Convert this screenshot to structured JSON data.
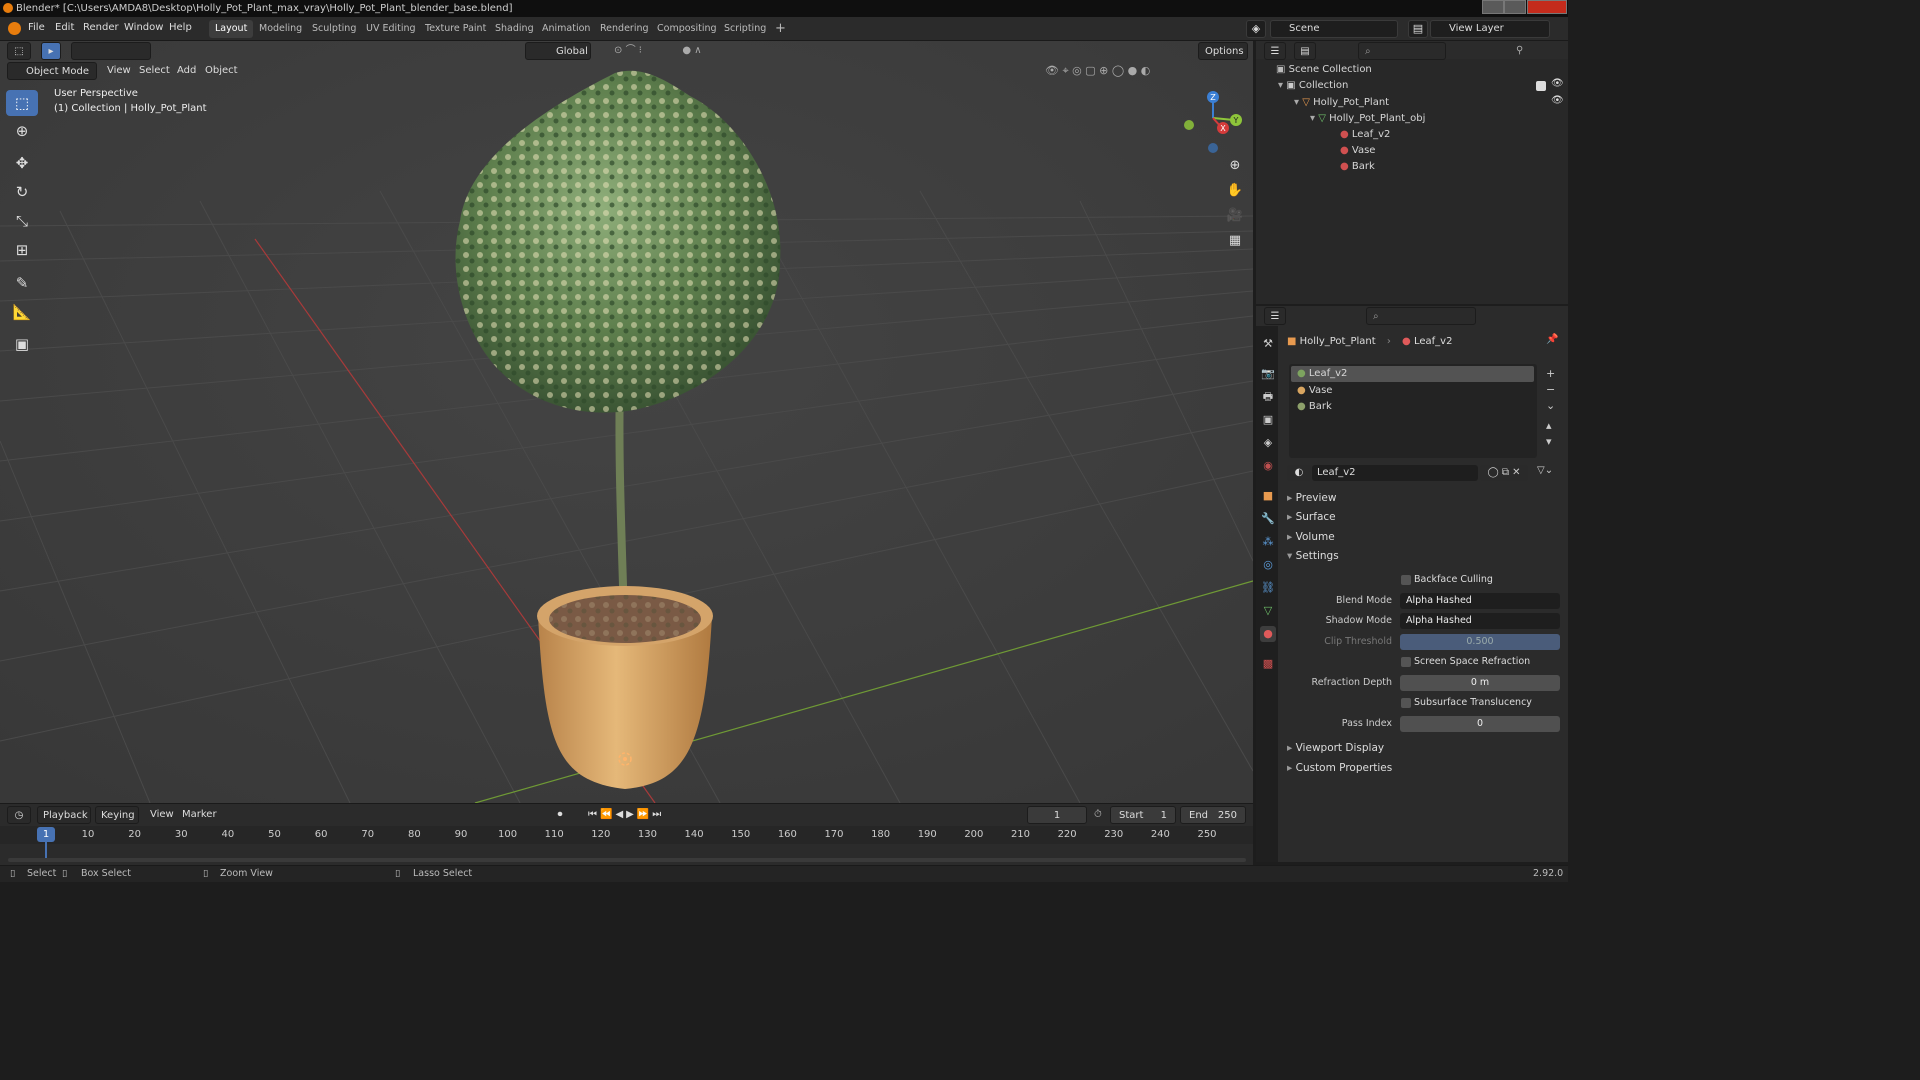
{
  "window": {
    "title": "Blender* [C:\\Users\\AMDA8\\Desktop\\Holly_Pot_Plant_max_vray\\Holly_Pot_Plant_blender_base.blend]"
  },
  "menu": [
    "File",
    "Edit",
    "Render",
    "Window",
    "Help"
  ],
  "workspaces": [
    "Layout",
    "Modeling",
    "Sculpting",
    "UV Editing",
    "Texture Paint",
    "Shading",
    "Animation",
    "Rendering",
    "Compositing",
    "Scripting"
  ],
  "active_workspace": "Layout",
  "scene": {
    "name": "Scene",
    "view_layer": "View Layer"
  },
  "viewport": {
    "orientation": "Global",
    "options": "Options",
    "mode": "Object Mode",
    "header_menus": [
      "View",
      "Select",
      "Add",
      "Object"
    ],
    "overlay_title": "User Perspective",
    "overlay_subtitle": "(1) Collection | Holly_Pot_Plant",
    "gizmo_axes": {
      "z": "Z",
      "y": "Y",
      "x": "X"
    }
  },
  "outliner": {
    "root": "Scene Collection",
    "collection": "Collection",
    "object": "Holly_Pot_Plant",
    "mesh": "Holly_Pot_Plant_obj",
    "materials": [
      "Leaf_v2",
      "Vase",
      "Bark"
    ]
  },
  "properties": {
    "breadcrumb_object": "Holly_Pot_Plant",
    "breadcrumb_material": "Leaf_v2",
    "material_slots": [
      "Leaf_v2",
      "Vase",
      "Bark"
    ],
    "active_material": "Leaf_v2",
    "panels": {
      "preview": "Preview",
      "surface": "Surface",
      "volume": "Volume",
      "settings": "Settings",
      "viewport_display": "Viewport Display",
      "custom_properties": "Custom Properties"
    },
    "settings": {
      "backface_culling": "Backface Culling",
      "blend_mode_label": "Blend Mode",
      "blend_mode": "Alpha Hashed",
      "shadow_mode_label": "Shadow Mode",
      "shadow_mode": "Alpha Hashed",
      "clip_threshold_label": "Clip Threshold",
      "clip_threshold": "0.500",
      "screen_space_refraction": "Screen Space Refraction",
      "refraction_depth_label": "Refraction Depth",
      "refraction_depth": "0 m",
      "subsurface_translucency": "Subsurface Translucency",
      "pass_index_label": "Pass Index",
      "pass_index": "0"
    }
  },
  "timeline": {
    "menus": [
      "Playback",
      "Keying",
      "View",
      "Marker"
    ],
    "current_frame": "1",
    "start_label": "Start",
    "start": "1",
    "end_label": "End",
    "end": "250",
    "ruler": [
      "1",
      "10",
      "20",
      "30",
      "40",
      "50",
      "60",
      "70",
      "80",
      "90",
      "100",
      "110",
      "120",
      "130",
      "140",
      "150",
      "160",
      "170",
      "180",
      "190",
      "200",
      "210",
      "220",
      "230",
      "240",
      "250"
    ]
  },
  "statusbar": {
    "select": "Select",
    "box_select": "Box Select",
    "zoom_view": "Zoom View",
    "lasso_select": "Lasso Select",
    "version": "2.92.0"
  },
  "colors": {
    "accent": "#4772b3",
    "x_axis": "#d43b3b",
    "y_axis": "#8ec53a",
    "z_axis": "#3b7fd4"
  }
}
